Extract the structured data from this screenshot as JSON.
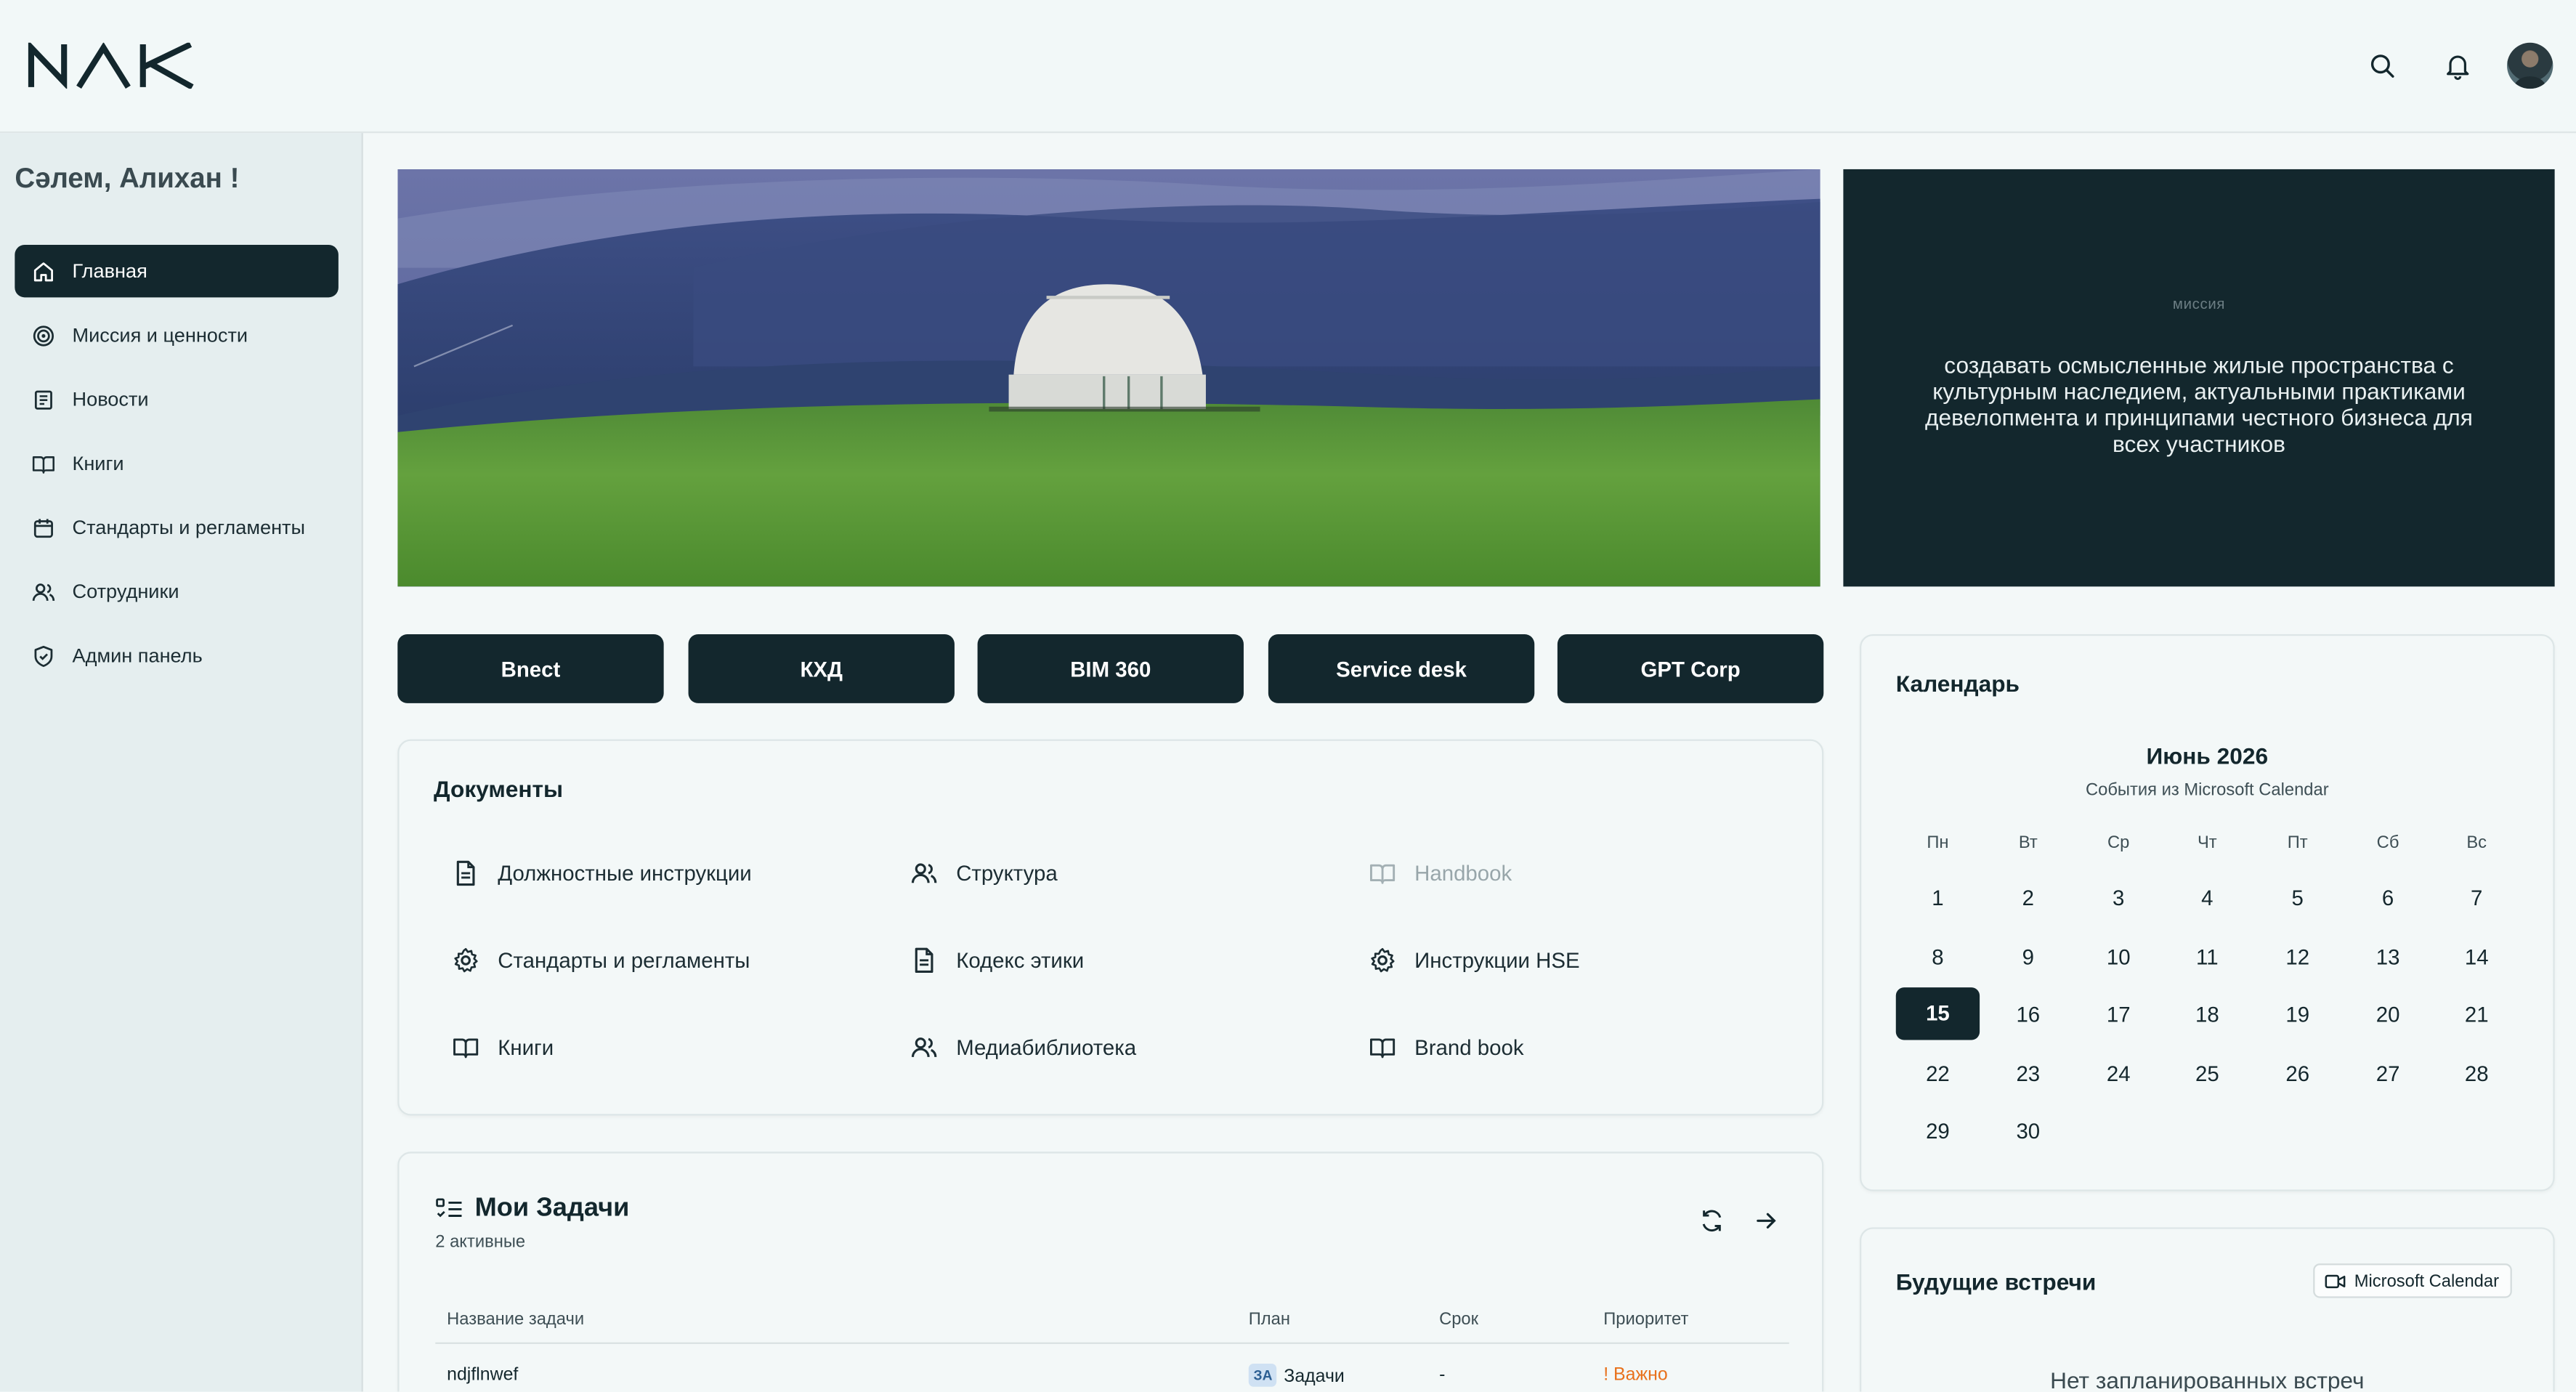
{
  "header": {
    "logo_text": "NAK",
    "search_icon": "search-icon",
    "bell_icon": "bell-icon"
  },
  "sidebar": {
    "greeting": "Сәлем, Алихан !",
    "items": [
      {
        "label": "Главная",
        "icon": "home-icon",
        "active": true
      },
      {
        "label": "Миссия и ценности",
        "icon": "target-icon"
      },
      {
        "label": "Новости",
        "icon": "newspaper-icon"
      },
      {
        "label": "Книги",
        "icon": "book-icon"
      },
      {
        "label": "Стандарты и регламенты",
        "icon": "calendar-icon"
      },
      {
        "label": "Сотрудники",
        "icon": "users-icon"
      },
      {
        "label": "Админ панель",
        "icon": "shield-icon"
      }
    ]
  },
  "mission": {
    "label": "миссия",
    "text": "создавать осмысленные жилые пространства с культурным наследием, актуальными практиками девелопмента и принципами честного бизнеса для всех участников"
  },
  "quick_links": [
    "Bnect",
    "КХД",
    "BIM 360",
    "Service desk",
    "GPT Corp"
  ],
  "documents": {
    "title": "Документы",
    "items": [
      {
        "label": "Должностные инструкции",
        "icon": "file-text-icon"
      },
      {
        "label": "Структура",
        "icon": "users-icon"
      },
      {
        "label": "Handbook",
        "icon": "book-open-icon",
        "muted": true
      },
      {
        "label": "Стандарты и регламенты",
        "icon": "gear-icon"
      },
      {
        "label": "Кодекс этики",
        "icon": "file-text-icon"
      },
      {
        "label": "Инструкции HSE",
        "icon": "gear-icon"
      },
      {
        "label": "Книги",
        "icon": "book-open-icon"
      },
      {
        "label": "Медиабиблиотека",
        "icon": "users-icon"
      },
      {
        "label": "Brand book",
        "icon": "book-open-icon"
      }
    ]
  },
  "tasks": {
    "title": "Мои Задачи",
    "subtitle": "2 активные",
    "columns": [
      "Название задачи",
      "План",
      "Срок",
      "Приоритет"
    ],
    "rows": [
      {
        "name": "ndjflnwef",
        "plan_badge": "ЗА",
        "plan": "Задачи",
        "due": "-",
        "priority": "! Важно"
      }
    ],
    "priority_color": "#e8711c"
  },
  "calendar": {
    "title": "Календарь",
    "month": "Июнь 2026",
    "subtitle": "События из Microsoft Calendar",
    "weekdays": [
      "Пн",
      "Вт",
      "Ср",
      "Чт",
      "Пт",
      "Сб",
      "Вс"
    ],
    "days": [
      "1",
      "2",
      "3",
      "4",
      "5",
      "6",
      "7",
      "8",
      "9",
      "10",
      "11",
      "12",
      "13",
      "14",
      "15",
      "16",
      "17",
      "18",
      "19",
      "20",
      "21",
      "22",
      "23",
      "24",
      "25",
      "26",
      "27",
      "28",
      "29",
      "30"
    ],
    "first_weekday_index": 0,
    "today": "15"
  },
  "meetings": {
    "title": "Будущие встречи",
    "button": "Microsoft Calendar",
    "empty": "Нет запланированных встреч"
  },
  "colors": {
    "primary": "#13272d",
    "background": "#f3f8f8",
    "sidebar": "#e5eeef"
  }
}
